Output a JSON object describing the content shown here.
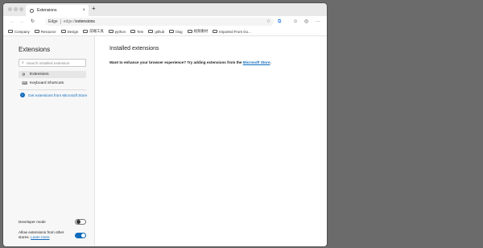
{
  "tab": {
    "title": "Extensions",
    "close": "×",
    "new_tab": "+"
  },
  "toolbar": {
    "back": "←",
    "forward": "→",
    "reload": "↻",
    "edge_label": "Edge",
    "url_scheme": "edge://",
    "url_host": "extensions",
    "star": "☆",
    "extensions_icon": "⧉",
    "profile_icon": "☺",
    "copilot_icon": "◎",
    "menu_icon": "···"
  },
  "bookmarks": [
    "Company",
    "Resource",
    "Design",
    "前端工具",
    "python",
    "Tem",
    "github",
    "blog",
    "视频素材",
    "Imported From Go..."
  ],
  "sidebar": {
    "title": "Extensions",
    "search_placeholder": "Search installed extension",
    "items": [
      {
        "label": "Extensions",
        "icon": "⚙"
      },
      {
        "label": "Keyboard Shortcuts",
        "icon": "⌨"
      }
    ],
    "store_link": "Get extensions from Microsoft Store",
    "developer_mode": {
      "label": "Developer mode",
      "enabled": false
    },
    "allow_other_stores": {
      "label": "Allow extensions from other stores.",
      "learn_more": "Learn more",
      "enabled": true
    }
  },
  "main": {
    "title": "Installed extensions",
    "message": "Want to enhance your browser experience? Try adding extensions from the ",
    "store_link": "Microsoft Store",
    "message_end": "."
  },
  "colors": {
    "accent": "#0f6cbd",
    "background": "#6b6b6b"
  }
}
